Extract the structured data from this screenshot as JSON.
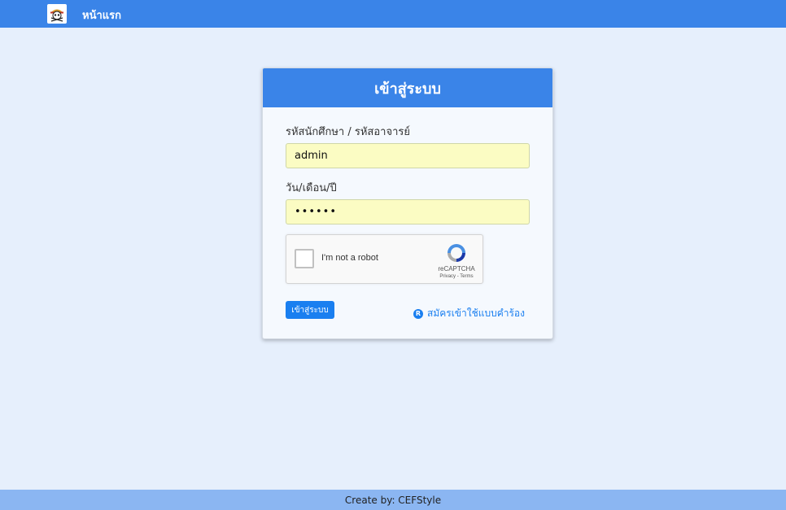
{
  "navbar": {
    "home_label": "หน้าแรก",
    "logo_icon": "skull-logo-icon"
  },
  "login_card": {
    "title": "เข้าสู่ระบบ",
    "username_label": "รหัสนักศึกษา / รหัสอาจารย์",
    "username_value": "admin",
    "password_label": "วัน/เดือน/ปี",
    "password_value": "••••••",
    "submit_label": "เข้าสู่ระบบ",
    "register_label": "สมัครเข้าใช้แบบคำร้อง",
    "register_icon": "registered-icon"
  },
  "recaptcha": {
    "checkbox_text": "I'm not a robot",
    "brand": "reCAPTCHA",
    "links": "Privacy - Terms"
  },
  "footer": {
    "text": "Create by: CEFStyle"
  },
  "colors": {
    "primary": "#3a84e8",
    "background": "#e6effc",
    "input_fill": "#fbfcc3",
    "button": "#1a7ff0",
    "footer": "#8bb6f2"
  }
}
